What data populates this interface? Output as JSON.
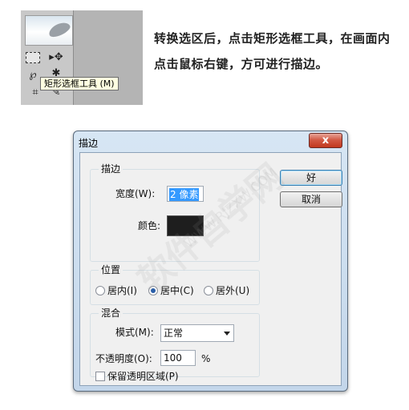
{
  "toolbar": {
    "tooltip": "矩形选框工具 (M)",
    "icons": [
      "feather-preview",
      "rect-marquee-icon",
      "move-icon",
      "lasso-icon",
      "magic-wand-icon",
      "crop-icon",
      "brush-icon"
    ]
  },
  "caption": "转换选区后，点击矩形选框工具，在画面内点击鼠标右键，方可进行描边。",
  "dialog": {
    "title": "描边",
    "close_glyph": "x",
    "stroke_group": {
      "label": "描边",
      "width_label": "宽度(W):",
      "width_value": "2 像素",
      "color_label": "颜色:",
      "color_value": "#1e1e1e"
    },
    "location_group": {
      "label": "位置",
      "options": [
        "居内(I)",
        "居中(C)",
        "居外(U)"
      ],
      "selected": "居中(C)"
    },
    "blend_group": {
      "label": "混合",
      "mode_label": "模式(M):",
      "mode_value": "正常",
      "opacity_label": "不透明度(O):",
      "opacity_value": "100",
      "opacity_unit": "%",
      "preserve_label": "保留透明区域(P)",
      "preserve_checked": false
    },
    "ok_label": "好",
    "cancel_label": "取消"
  },
  "watermark": {
    "text": "软件自学网",
    "url": "WWW.RJZXW.COM"
  }
}
